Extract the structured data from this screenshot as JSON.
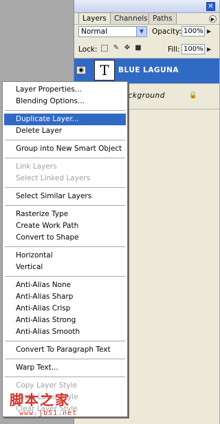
{
  "panel": {
    "tabs": [
      {
        "label": "Layers",
        "active": true
      },
      {
        "label": "Channels",
        "active": false
      },
      {
        "label": "Paths",
        "active": false
      }
    ],
    "close_glyph": "✕",
    "menu_glyph": "▶",
    "blend_mode": "Normal",
    "opacity_label": "Opacity:",
    "opacity_value": "100%",
    "lock_label": "Lock:",
    "fill_label": "Fill:",
    "fill_value": "100%",
    "layers": [
      {
        "thumb_glyph": "T",
        "name": "BLUE   LAGUNA",
        "selected": true
      },
      {
        "name": "Background",
        "locked": true
      }
    ],
    "colors": {
      "selection": "#316ac5",
      "panel_bg": "#ece9d8"
    }
  },
  "context_menu": {
    "items": [
      {
        "label": "Layer Properties...",
        "state": "normal"
      },
      {
        "label": "Blending Options...",
        "state": "normal"
      },
      {
        "label": "Duplicate Layer...",
        "state": "highlighted"
      },
      {
        "label": "Delete Layer",
        "state": "normal"
      },
      {
        "label": "Group into New Smart Object",
        "state": "normal"
      },
      {
        "label": "Link Layers",
        "state": "disabled"
      },
      {
        "label": "Select Linked Layers",
        "state": "disabled"
      },
      {
        "label": "Select Similar Layers",
        "state": "normal"
      },
      {
        "label": "Rasterize Type",
        "state": "normal"
      },
      {
        "label": "Create Work Path",
        "state": "normal"
      },
      {
        "label": "Convert to Shape",
        "state": "normal"
      },
      {
        "label": "Horizontal",
        "state": "normal"
      },
      {
        "label": "Vertical",
        "state": "normal"
      },
      {
        "label": "Anti-Alias None",
        "state": "normal"
      },
      {
        "label": "Anti-Alias Sharp",
        "state": "normal"
      },
      {
        "label": "Anti-Alias Crisp",
        "state": "normal"
      },
      {
        "label": "Anti-Alias Strong",
        "state": "normal"
      },
      {
        "label": "Anti-Alias Smooth",
        "state": "normal"
      },
      {
        "label": "Convert To Paragraph Text",
        "state": "normal"
      },
      {
        "label": "Warp Text...",
        "state": "normal"
      },
      {
        "label": "Copy Layer Style",
        "state": "disabled"
      },
      {
        "label": "Paste Layer Style",
        "state": "disabled"
      },
      {
        "label": "Clear Layer Style",
        "state": "disabled"
      }
    ]
  },
  "watermark": {
    "logo": "脚本之家",
    "url": "www.jb51.net"
  }
}
